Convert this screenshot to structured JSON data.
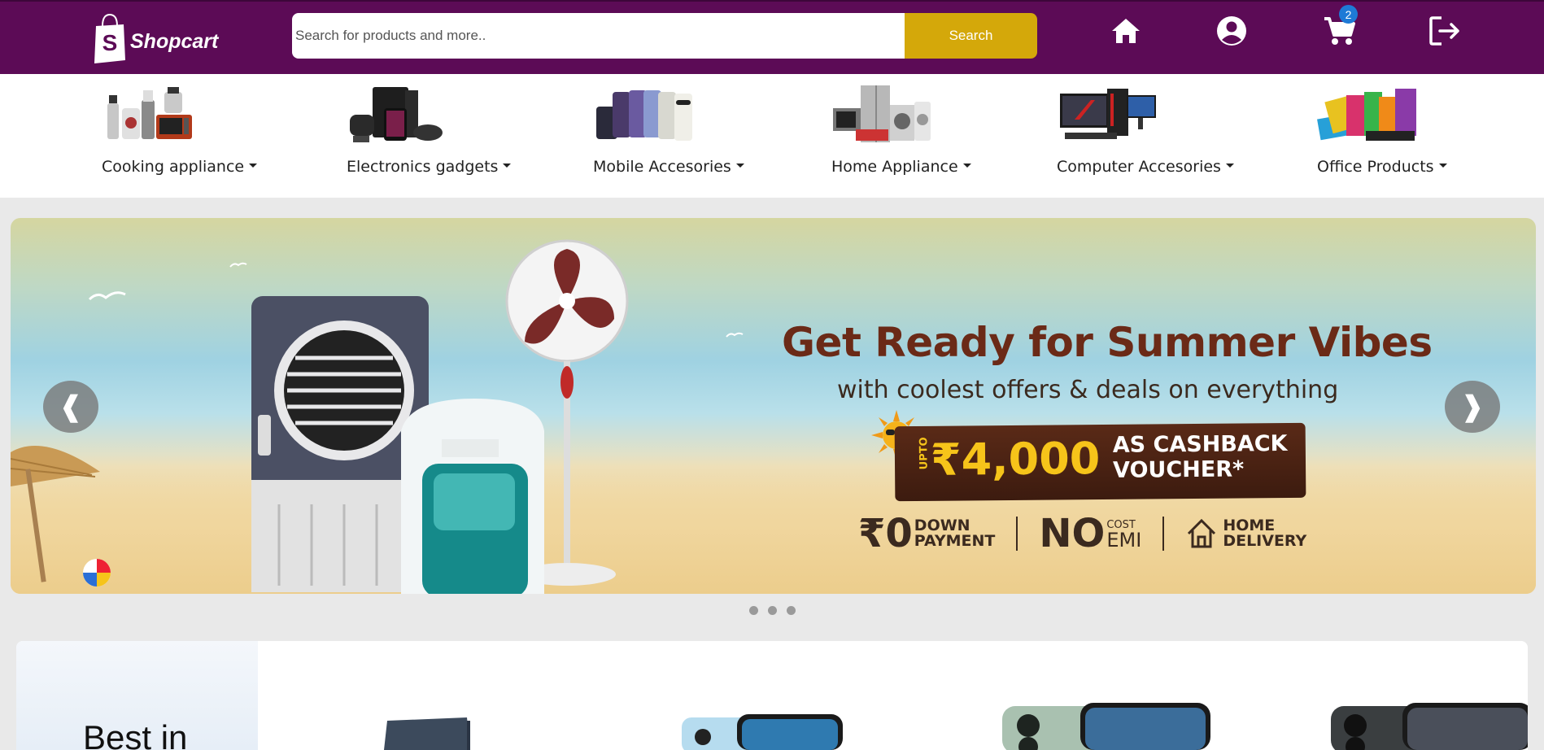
{
  "header": {
    "logo_text": "Shopcart",
    "logo_letter": "S",
    "search_placeholder": "Search for products and more..",
    "search_button": "Search",
    "cart_count": "2",
    "icons": [
      "home-icon",
      "account-icon",
      "cart-icon",
      "logout-icon"
    ],
    "colors": {
      "bar": "#5c0b56",
      "search_button": "#d4a80a",
      "badge": "#1e7ad6"
    }
  },
  "categories": [
    {
      "label": "Cooking appliance"
    },
    {
      "label": "Electronics gadgets"
    },
    {
      "label": "Mobile Accesories"
    },
    {
      "label": "Home Appliance"
    },
    {
      "label": "Computer Accesories"
    },
    {
      "label": "Office Products"
    }
  ],
  "banner": {
    "title": "Get Ready for Summer Vibes",
    "subtitle": "with coolest offers & deals on everything",
    "voucher_upto": "UPTO",
    "voucher_amount": "₹4,000",
    "voucher_line1": "AS CASHBACK",
    "voucher_line2": "VOUCHER*",
    "perk1_big": "₹0",
    "perk1_line1": "DOWN",
    "perk1_line2": "PAYMENT",
    "perk2_big": "NO",
    "perk2_line1": "COST",
    "perk2_line2": "EMI",
    "perk3_line1": "HOME",
    "perk3_line2": "DELIVERY",
    "prev_label": "❰",
    "next_label": "❱",
    "slide_count": 3
  },
  "best": {
    "title": "Best in"
  }
}
